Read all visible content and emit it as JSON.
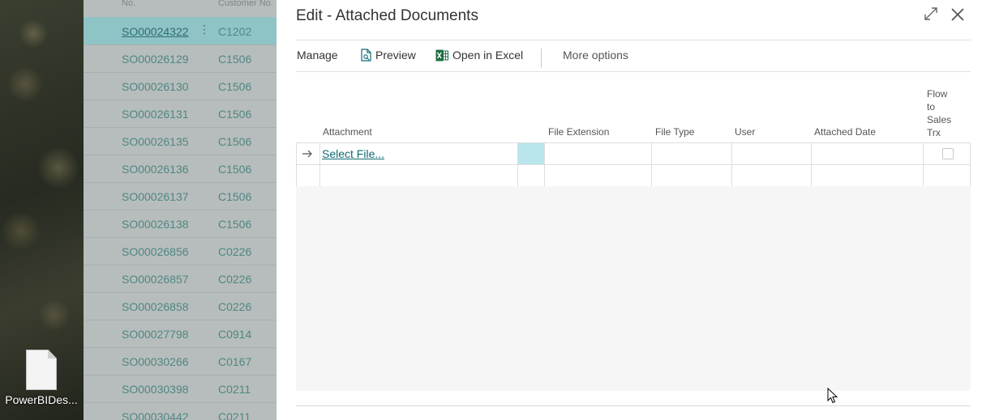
{
  "desktop": {
    "icon_label": "PowerBIDes..."
  },
  "background_list": {
    "headers": {
      "no": "No.",
      "customer_no": "Customer No."
    },
    "rows": [
      {
        "no": "SO00024322",
        "customer": "C1202"
      },
      {
        "no": "SO00026129",
        "customer": "C1506"
      },
      {
        "no": "SO00026130",
        "customer": "C1506"
      },
      {
        "no": "SO00026131",
        "customer": "C1506"
      },
      {
        "no": "SO00026135",
        "customer": "C1506"
      },
      {
        "no": "SO00026136",
        "customer": "C1506"
      },
      {
        "no": "SO00026137",
        "customer": "C1506"
      },
      {
        "no": "SO00026138",
        "customer": "C1506"
      },
      {
        "no": "SO00026856",
        "customer": "C0226"
      },
      {
        "no": "SO00026857",
        "customer": "C0226"
      },
      {
        "no": "SO00026858",
        "customer": "C0226"
      },
      {
        "no": "SO00027798",
        "customer": "C0914"
      },
      {
        "no": "SO00030266",
        "customer": "C0167"
      },
      {
        "no": "SO00030398",
        "customer": "C0211"
      },
      {
        "no": "SO00030442",
        "customer": "C0211"
      }
    ],
    "row_menu_glyph": "⋮"
  },
  "dialog": {
    "title": "Edit - Attached Documents",
    "toolbar": {
      "manage": "Manage",
      "preview": "Preview",
      "open_in_excel": "Open in Excel",
      "more_options": "More options"
    },
    "columns": {
      "attachment": "Attachment",
      "file_extension": "File Extension",
      "file_type": "File Type",
      "user": "User",
      "attached_date": "Attached Date",
      "flow_to_sales_trx": [
        "Flow",
        "to",
        "Sales",
        "Trx"
      ]
    },
    "rows": [
      {
        "attachment": "Select File...",
        "file_extension": "",
        "file_type": "",
        "user": "",
        "attached_date": ""
      },
      {
        "attachment": "",
        "file_extension": "",
        "file_type": "",
        "user": "",
        "attached_date": ""
      }
    ]
  },
  "colors": {
    "accent": "#0f6a73",
    "selected_cell": "#b8e6ec"
  }
}
